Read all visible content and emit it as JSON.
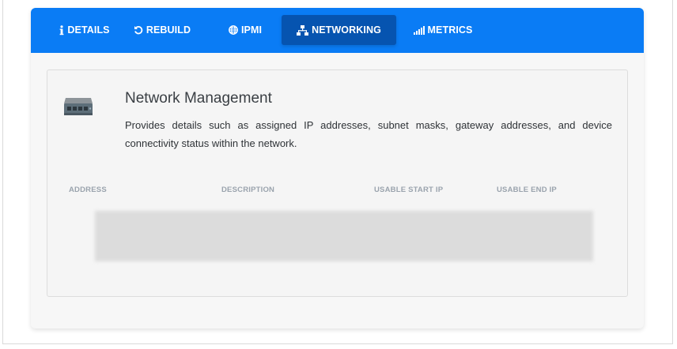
{
  "tabs": [
    {
      "label": "DETAILS",
      "icon": "info-icon"
    },
    {
      "label": "REBUILD",
      "icon": "undo-icon"
    },
    {
      "label": "IPMI",
      "icon": "globe-icon"
    },
    {
      "label": "NETWORKING",
      "icon": "network-icon",
      "active": true
    },
    {
      "label": "METRICS",
      "icon": "signal-bars-icon"
    }
  ],
  "section": {
    "icon": "network-switch-icon",
    "title": "Network Management",
    "description": "Provides details such as assigned IP addresses, subnet masks, gateway addresses, and device connectivity status within the network."
  },
  "table": {
    "columns": [
      "ADDRESS",
      "DESCRIPTION",
      "USABLE START IP",
      "USABLE END IP"
    ]
  },
  "colors": {
    "tabbar": "#0a7cf5",
    "active_tab": "#0654b0",
    "header_text": "#9aa3ad"
  }
}
